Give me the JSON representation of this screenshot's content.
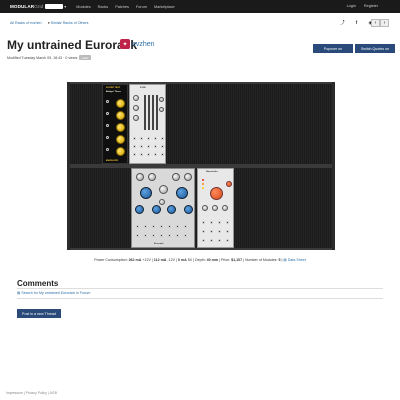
{
  "topbar": {
    "brand_main": "MODULAR",
    "brand_sub": "Grid",
    "nav": [
      "Modules",
      "Racks",
      "Patches",
      "Forum",
      "Marketplace"
    ],
    "login": "Login",
    "register": "Register"
  },
  "subnav": {
    "all_racks": "All Racks of evzhen",
    "similar_racks": "Similar Racks of Others"
  },
  "rack": {
    "title": "My untrained Eurorack",
    "author": "evzhen",
    "modified": "Modified Tuesday March 09, 18:43 · 0 views",
    "badge": "public",
    "popup_btn": "Popover on",
    "switch_btn": "Switch Quotes on",
    "module_labels": {
      "yellow_top": "N-STEP TEST",
      "yellow_mid": "Bridge / Timer",
      "yellow_bottom": "ENVELOPE",
      "white_top": "E-RM",
      "grey_mid": "Eurorack",
      "white_right": "Wavefolder"
    }
  },
  "stats": {
    "prefix": "Power Consumption:",
    "p12": "262 mA",
    "p12_label": "+12V |",
    "m12": "112 mA",
    "m12_label": "-12V |",
    "p5": "0 mA",
    "p5_label": "5V | Depth:",
    "depth": "40 mm",
    "price_label": "| Price:",
    "price": "$1,107",
    "modules_label": "| Number of Modules:",
    "modules": "5",
    "data_sheet": "Data Sheet"
  },
  "comments": {
    "heading": "Comments",
    "forum_link": "Search for My untrained Eurorack in Forum",
    "post_button": "Post in a new Thread"
  },
  "footer": {
    "impressum": "Impressum",
    "privacy": "Privacy Policy",
    "agb": "AGB"
  },
  "colors": {
    "topbar": "#1a1a1a",
    "link": "#2c6ea6",
    "button": "#2a4a7a",
    "rack_bg": "#2b2b2b",
    "knob_yellow": "#e8b800",
    "knob_blue": "#2c6ea6"
  }
}
